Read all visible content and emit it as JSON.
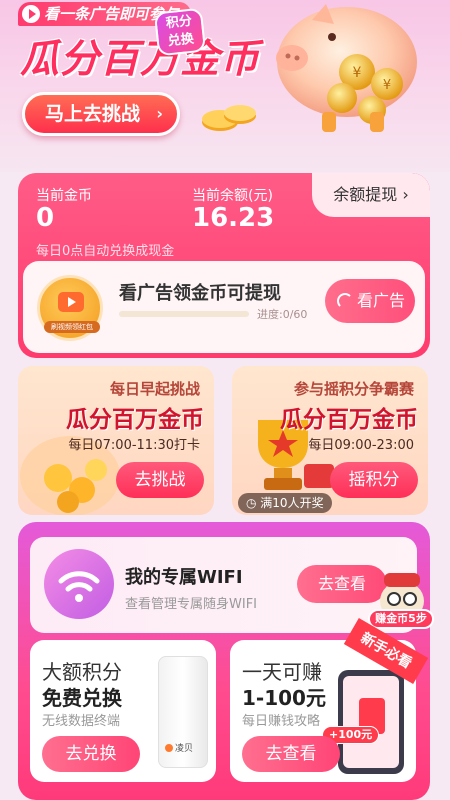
{
  "hero": {
    "tag": "看一条广告即可参与",
    "title": "瓜分百万金币",
    "cta": "马上去挑战",
    "cta_chevron": "›"
  },
  "balance": {
    "coins_label": "当前金币",
    "coins_value": "0",
    "cash_label": "当前余额(元)",
    "cash_value": "16.23",
    "withdraw_label": "余额提现",
    "withdraw_chevron": "›",
    "auto_note": "每日0点自动兑换成现金"
  },
  "ad_task": {
    "thumb_caption": "刷视频领红包",
    "title": "看广告领金币可提现",
    "progress_text": "进度:0/60",
    "progress_fraction": 0,
    "button": "看广告"
  },
  "challenges": [
    {
      "subtitle": "每日早起挑战",
      "title": "瓜分百万金币",
      "time": "每日07:00-11:30打卡",
      "button": "去挑战"
    },
    {
      "subtitle": "参与摇积分争霸赛",
      "title": "瓜分百万金币",
      "time": "每日09:00-23:00",
      "button": "摇积分",
      "badge": "满10人开奖"
    }
  ],
  "wifi": {
    "title": "我的专属WIFI",
    "desc": "查看管理专属随身WIFI",
    "button": "去查看",
    "mascot_tag": "赚金币5步"
  },
  "exchange": {
    "title": "大额积分",
    "big": "免费兑换",
    "sub": "无线数据终端",
    "button": "去兑换",
    "badge_line1": "积分",
    "badge_line2": "兑换",
    "device_brand": "凌贝"
  },
  "earn": {
    "title": "一天可赚",
    "big": "1-100元",
    "sub": "每日赚钱攻略",
    "button": "去查看",
    "phone_tag": "+100元",
    "corner": "新手必看"
  },
  "colors": {
    "primary": "#ff3b6d",
    "accent_gold": "#ffb43b",
    "bg": "#f6e9f4"
  }
}
